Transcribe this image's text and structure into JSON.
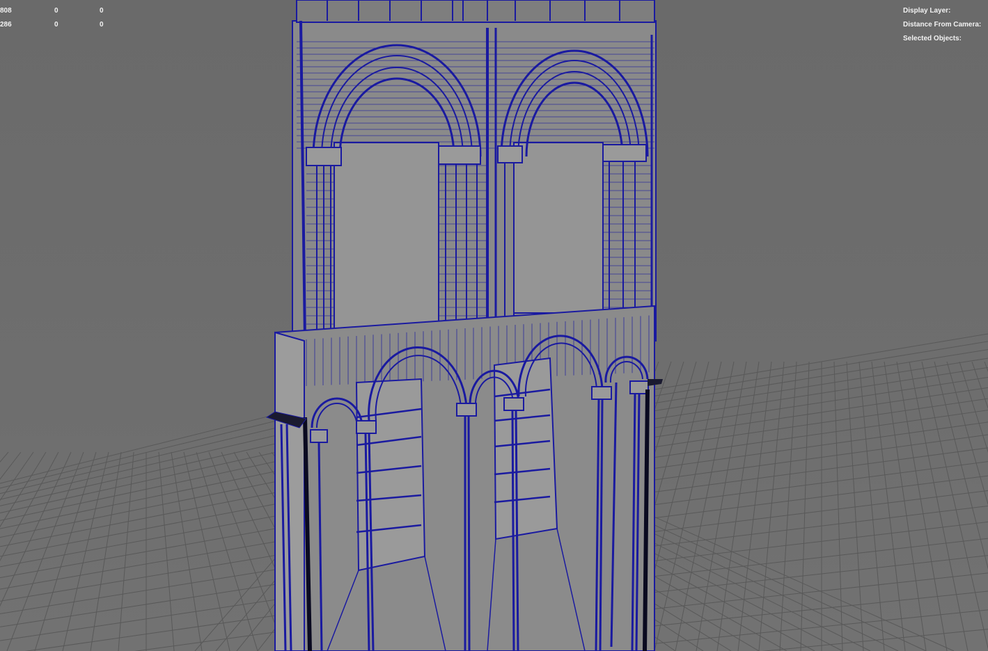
{
  "hud_left": {
    "rows": [
      {
        "label": "808",
        "v1": "0",
        "v2": "0"
      },
      {
        "label": "286",
        "v1": "0",
        "v2": "0"
      }
    ]
  },
  "hud_right": {
    "display_layer_label": "Display Layer:",
    "distance_from_camera_label": "Distance From Camera:",
    "selected_objects_label": "Selected Objects:"
  },
  "colors": {
    "background": "#6b6b6b",
    "grid_line": "#5a5a5a",
    "mesh_face": "#8c8c8c",
    "wireframe": "#1a1aa0",
    "hud_text": "#f2f2f2"
  }
}
